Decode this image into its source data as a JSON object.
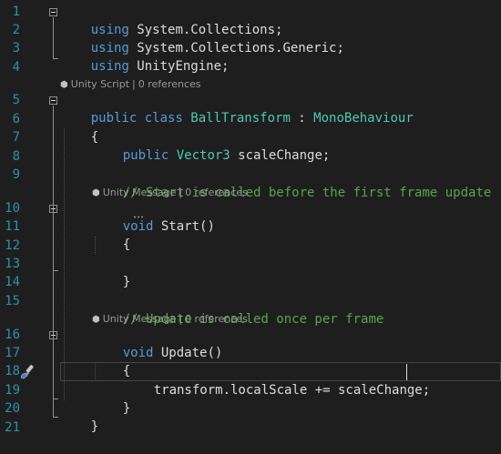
{
  "editor": {
    "line_numbers": [
      "1",
      "2",
      "3",
      "4",
      "5",
      "6",
      "7",
      "8",
      "9",
      "10",
      "11",
      "12",
      "13",
      "14",
      "15",
      "16",
      "17",
      "18",
      "19",
      "20",
      "21"
    ],
    "code": {
      "using_kw": "using",
      "using1_ns": " System.Collections;",
      "using2_ns": " System.Collections.Generic;",
      "using3_ns": " UnityEngine;",
      "public_class_kw": "public class ",
      "class_name": "BallTransform",
      "colon": " : ",
      "base_class": "MonoBehaviour",
      "open_brace": "{",
      "close_brace": "}",
      "field_kw": "public ",
      "field_type": "Vector3",
      "field_name": " scaleChange;",
      "comment_start": "// Start is called before the first frame update",
      "void_kw": "void ",
      "start_name": "Start",
      "parens": "()",
      "comment_update": "// Update is called once per frame",
      "update_name": "Update",
      "stmt": "transform.localScale += scaleChange;"
    },
    "codelens": {
      "class_lens": "Unity Script",
      "start_lens": "Unity Message",
      "update_lens": "Unity Message",
      "separator": "|",
      "references": "0 references"
    },
    "icons": {
      "unity": "unity-cube-icon",
      "quick_action": "paintbrush-icon"
    },
    "colors": {
      "background": "#1e1e1e",
      "keyword": "#569cd6",
      "type": "#4ec9b0",
      "comment": "#57a64a",
      "line_number": "#2b91af"
    }
  }
}
